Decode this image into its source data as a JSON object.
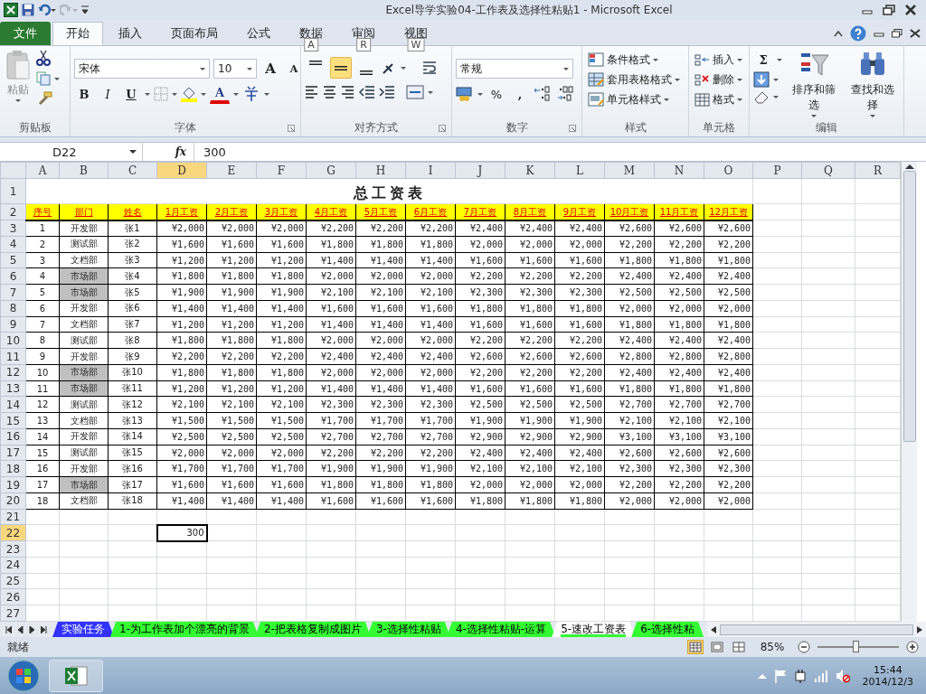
{
  "window": {
    "title": "Excel导学实验04-工作表及选择性粘贴1  -  Microsoft Excel"
  },
  "ribbon": {
    "file_tab": "文件",
    "tabs": [
      {
        "label": "开始",
        "selected": true
      },
      {
        "label": "插入",
        "selected": false
      },
      {
        "label": "页面布局",
        "selected": false
      },
      {
        "label": "公式",
        "selected": false
      },
      {
        "label": "数据",
        "selected": false,
        "key_tip": "A"
      },
      {
        "label": "审阅",
        "selected": false,
        "key_tip": "R"
      },
      {
        "label": "视图",
        "selected": false,
        "key_tip": "W"
      }
    ],
    "clipboard": {
      "label": "剪贴板",
      "paste": "粘贴"
    },
    "font": {
      "label": "字体",
      "font_name": "宋体",
      "font_size": "10",
      "grow": "A",
      "shrink": "A",
      "bold": "B",
      "italic": "I",
      "underline": "U",
      "font_color": "A"
    },
    "alignment": {
      "label": "对齐方式",
      "vertical": [
        {
          "kind": "top",
          "selected": false
        },
        {
          "kind": "middle",
          "selected": true
        },
        {
          "kind": "bottom",
          "selected": false
        }
      ]
    },
    "number": {
      "label": "数字",
      "format": "常规",
      "percent": "%",
      "comma": ","
    },
    "styles": {
      "label": "样式",
      "items": [
        "条件格式",
        "套用表格格式",
        "单元格样式"
      ]
    },
    "cells": {
      "label": "单元格",
      "items": [
        "插入",
        "删除",
        "格式"
      ]
    },
    "editing": {
      "label": "编辑",
      "sum": "Σ",
      "items": [
        "排序和筛选",
        "查找和选择"
      ]
    }
  },
  "formula_bar": {
    "name_box": "D22",
    "function_label": "fx",
    "value": "300"
  },
  "sheet": {
    "columns": [
      {
        "label": "A",
        "selected": false
      },
      {
        "label": "B",
        "selected": false
      },
      {
        "label": "C",
        "selected": false
      },
      {
        "label": "D",
        "selected": true
      },
      {
        "label": "E",
        "selected": false
      },
      {
        "label": "F",
        "selected": false
      },
      {
        "label": "G",
        "selected": false
      },
      {
        "label": "H",
        "selected": false
      },
      {
        "label": "I",
        "selected": false
      },
      {
        "label": "J",
        "selected": false
      },
      {
        "label": "K",
        "selected": false
      },
      {
        "label": "L",
        "selected": false
      },
      {
        "label": "M",
        "selected": false
      },
      {
        "label": "N",
        "selected": false
      },
      {
        "label": "O",
        "selected": false
      },
      {
        "label": "P",
        "selected": false
      },
      {
        "label": "Q",
        "selected": false
      },
      {
        "label": "R",
        "selected": false
      }
    ],
    "row_numbers": [
      {
        "label": "1",
        "selected": false
      },
      {
        "label": "2",
        "selected": false
      },
      {
        "label": "3",
        "selected": false
      },
      {
        "label": "4",
        "selected": false
      },
      {
        "label": "5",
        "selected": false
      },
      {
        "label": "6",
        "selected": false
      },
      {
        "label": "7",
        "selected": false
      },
      {
        "label": "8",
        "selected": false
      },
      {
        "label": "9",
        "selected": false
      },
      {
        "label": "10",
        "selected": false
      },
      {
        "label": "11",
        "selected": false
      },
      {
        "label": "12",
        "selected": false
      },
      {
        "label": "13",
        "selected": false
      },
      {
        "label": "14",
        "selected": false
      },
      {
        "label": "15",
        "selected": false
      },
      {
        "label": "16",
        "selected": false
      },
      {
        "label": "17",
        "selected": false
      },
      {
        "label": "18",
        "selected": false
      },
      {
        "label": "19",
        "selected": false
      },
      {
        "label": "20",
        "selected": false
      },
      {
        "label": "21",
        "selected": false
      },
      {
        "label": "22",
        "selected": true
      },
      {
        "label": "23",
        "selected": false
      },
      {
        "label": "24",
        "selected": false
      },
      {
        "label": "25",
        "selected": false
      },
      {
        "label": "26",
        "selected": false
      },
      {
        "label": "27",
        "selected": false
      }
    ],
    "title": "总工资表",
    "header": [
      "序号",
      "部门",
      "姓名",
      "1月工资",
      "2月工资",
      "3月工资",
      "4月工资",
      "5月工资",
      "6月工资",
      "7月工资",
      "8月工资",
      "9月工资",
      "10月工资",
      "11月工资",
      "12月工资"
    ],
    "records": [
      {
        "no": "1",
        "dept": "开发部",
        "name": "张1",
        "highlighted": false,
        "salaries": [
          "¥2,000",
          "¥2,000",
          "¥2,000",
          "¥2,200",
          "¥2,200",
          "¥2,200",
          "¥2,400",
          "¥2,400",
          "¥2,400",
          "¥2,600",
          "¥2,600",
          "¥2,600"
        ]
      },
      {
        "no": "2",
        "dept": "测试部",
        "name": "张2",
        "highlighted": false,
        "salaries": [
          "¥1,600",
          "¥1,600",
          "¥1,600",
          "¥1,800",
          "¥1,800",
          "¥1,800",
          "¥2,000",
          "¥2,000",
          "¥2,000",
          "¥2,200",
          "¥2,200",
          "¥2,200"
        ]
      },
      {
        "no": "3",
        "dept": "文档部",
        "name": "张3",
        "highlighted": false,
        "salaries": [
          "¥1,200",
          "¥1,200",
          "¥1,200",
          "¥1,400",
          "¥1,400",
          "¥1,400",
          "¥1,600",
          "¥1,600",
          "¥1,600",
          "¥1,800",
          "¥1,800",
          "¥1,800"
        ]
      },
      {
        "no": "4",
        "dept": "市场部",
        "name": "张4",
        "highlighted": true,
        "salaries": [
          "¥1,800",
          "¥1,800",
          "¥1,800",
          "¥2,000",
          "¥2,000",
          "¥2,000",
          "¥2,200",
          "¥2,200",
          "¥2,200",
          "¥2,400",
          "¥2,400",
          "¥2,400"
        ]
      },
      {
        "no": "5",
        "dept": "市场部",
        "name": "张5",
        "highlighted": true,
        "salaries": [
          "¥1,900",
          "¥1,900",
          "¥1,900",
          "¥2,100",
          "¥2,100",
          "¥2,100",
          "¥2,300",
          "¥2,300",
          "¥2,300",
          "¥2,500",
          "¥2,500",
          "¥2,500"
        ]
      },
      {
        "no": "6",
        "dept": "开发部",
        "name": "张6",
        "highlighted": false,
        "salaries": [
          "¥1,400",
          "¥1,400",
          "¥1,400",
          "¥1,600",
          "¥1,600",
          "¥1,600",
          "¥1,800",
          "¥1,800",
          "¥1,800",
          "¥2,000",
          "¥2,000",
          "¥2,000"
        ]
      },
      {
        "no": "7",
        "dept": "文档部",
        "name": "张7",
        "highlighted": false,
        "salaries": [
          "¥1,200",
          "¥1,200",
          "¥1,200",
          "¥1,400",
          "¥1,400",
          "¥1,400",
          "¥1,600",
          "¥1,600",
          "¥1,600",
          "¥1,800",
          "¥1,800",
          "¥1,800"
        ]
      },
      {
        "no": "8",
        "dept": "测试部",
        "name": "张8",
        "highlighted": false,
        "salaries": [
          "¥1,800",
          "¥1,800",
          "¥1,800",
          "¥2,000",
          "¥2,000",
          "¥2,000",
          "¥2,200",
          "¥2,200",
          "¥2,200",
          "¥2,400",
          "¥2,400",
          "¥2,400"
        ]
      },
      {
        "no": "9",
        "dept": "开发部",
        "name": "张9",
        "highlighted": false,
        "salaries": [
          "¥2,200",
          "¥2,200",
          "¥2,200",
          "¥2,400",
          "¥2,400",
          "¥2,400",
          "¥2,600",
          "¥2,600",
          "¥2,600",
          "¥2,800",
          "¥2,800",
          "¥2,800"
        ]
      },
      {
        "no": "10",
        "dept": "市场部",
        "name": "张10",
        "highlighted": true,
        "salaries": [
          "¥1,800",
          "¥1,800",
          "¥1,800",
          "¥2,000",
          "¥2,000",
          "¥2,000",
          "¥2,200",
          "¥2,200",
          "¥2,200",
          "¥2,400",
          "¥2,400",
          "¥2,400"
        ]
      },
      {
        "no": "11",
        "dept": "市场部",
        "name": "张11",
        "highlighted": true,
        "salaries": [
          "¥1,200",
          "¥1,200",
          "¥1,200",
          "¥1,400",
          "¥1,400",
          "¥1,400",
          "¥1,600",
          "¥1,600",
          "¥1,600",
          "¥1,800",
          "¥1,800",
          "¥1,800"
        ]
      },
      {
        "no": "12",
        "dept": "测试部",
        "name": "张12",
        "highlighted": false,
        "salaries": [
          "¥2,100",
          "¥2,100",
          "¥2,100",
          "¥2,300",
          "¥2,300",
          "¥2,300",
          "¥2,500",
          "¥2,500",
          "¥2,500",
          "¥2,700",
          "¥2,700",
          "¥2,700"
        ]
      },
      {
        "no": "13",
        "dept": "文档部",
        "name": "张13",
        "highlighted": false,
        "salaries": [
          "¥1,500",
          "¥1,500",
          "¥1,500",
          "¥1,700",
          "¥1,700",
          "¥1,700",
          "¥1,900",
          "¥1,900",
          "¥1,900",
          "¥2,100",
          "¥2,100",
          "¥2,100"
        ]
      },
      {
        "no": "14",
        "dept": "开发部",
        "name": "张14",
        "highlighted": false,
        "salaries": [
          "¥2,500",
          "¥2,500",
          "¥2,500",
          "¥2,700",
          "¥2,700",
          "¥2,700",
          "¥2,900",
          "¥2,900",
          "¥2,900",
          "¥3,100",
          "¥3,100",
          "¥3,100"
        ]
      },
      {
        "no": "15",
        "dept": "测试部",
        "name": "张15",
        "highlighted": false,
        "salaries": [
          "¥2,000",
          "¥2,000",
          "¥2,000",
          "¥2,200",
          "¥2,200",
          "¥2,200",
          "¥2,400",
          "¥2,400",
          "¥2,400",
          "¥2,600",
          "¥2,600",
          "¥2,600"
        ]
      },
      {
        "no": "16",
        "dept": "开发部",
        "name": "张16",
        "highlighted": false,
        "salaries": [
          "¥1,700",
          "¥1,700",
          "¥1,700",
          "¥1,900",
          "¥1,900",
          "¥1,900",
          "¥2,100",
          "¥2,100",
          "¥2,100",
          "¥2,300",
          "¥2,300",
          "¥2,300"
        ]
      },
      {
        "no": "17",
        "dept": "市场部",
        "name": "张17",
        "highlighted": true,
        "salaries": [
          "¥1,600",
          "¥1,600",
          "¥1,600",
          "¥1,800",
          "¥1,800",
          "¥1,800",
          "¥2,000",
          "¥2,000",
          "¥2,000",
          "¥2,200",
          "¥2,200",
          "¥2,200"
        ]
      },
      {
        "no": "18",
        "dept": "文档部",
        "name": "张18",
        "highlighted": false,
        "salaries": [
          "¥1,400",
          "¥1,400",
          "¥1,400",
          "¥1,600",
          "¥1,600",
          "¥1,600",
          "¥1,800",
          "¥1,800",
          "¥1,800",
          "¥2,000",
          "¥2,000",
          "¥2,000"
        ]
      }
    ],
    "active_cell": {
      "value": "300",
      "selected": true
    }
  },
  "sheet_tabs": [
    {
      "label": "实验任务",
      "color": "#3333ff",
      "selected": false
    },
    {
      "label": "1-为工作表加个漂亮的背景",
      "color": "#33ff33",
      "selected": false
    },
    {
      "label": "2-把表格复制成图片",
      "color": "#33ff33",
      "selected": false
    },
    {
      "label": "3-选择性粘贴",
      "color": "#33ff33",
      "selected": false
    },
    {
      "label": "4-选择性粘贴-运算",
      "color": "#33ff33",
      "selected": false
    },
    {
      "label": "5-速改工资表",
      "color": "#33ff33",
      "selected": true
    },
    {
      "label": "6-选择性粘",
      "color": "#33ff33",
      "selected": false
    }
  ],
  "status_bar": {
    "status": "就绪",
    "views": [
      {
        "kind": "normal",
        "selected": true
      },
      {
        "kind": "layout",
        "selected": false
      },
      {
        "kind": "pagebreak",
        "selected": false
      }
    ],
    "zoom": "85%",
    "zoom_slider": {
      "level": 0.47
    }
  },
  "taskbar": {
    "time": "15:44",
    "date": "2014/12/3"
  }
}
